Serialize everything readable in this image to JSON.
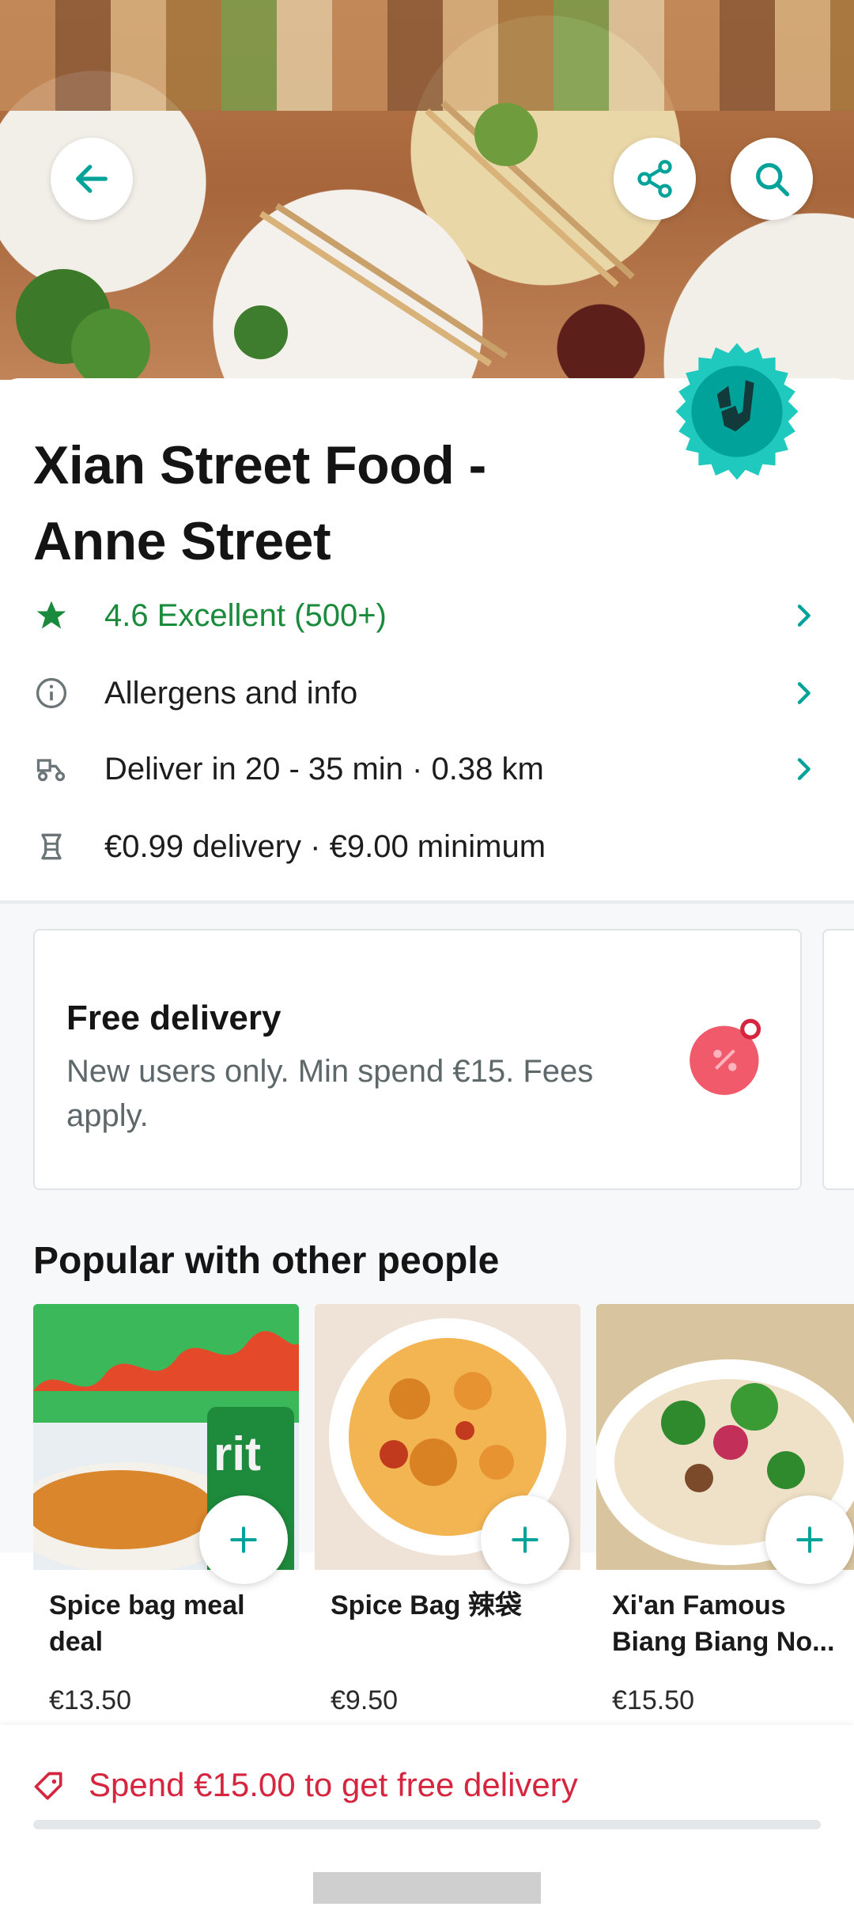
{
  "header": {
    "back_icon": "arrow-left-icon",
    "share_icon": "share-icon",
    "search_icon": "search-icon"
  },
  "restaurant": {
    "name": "Xian Street Food - Anne Street",
    "rating_text": "4.6 Excellent (500+)",
    "allergens_text": "Allergens and info",
    "delivery_time_text": "Deliver in 20 - 35 min · 0.38 km",
    "fees_text": "€0.99 delivery · €9.00 minimum"
  },
  "promo": {
    "title": "Free delivery",
    "description": "New users only. Min spend €15. Fees apply."
  },
  "popular": {
    "heading": "Popular with other people",
    "items": [
      {
        "name": "Spice bag meal deal",
        "price": "€13.50"
      },
      {
        "name": "Spice Bag 辣袋",
        "price": "€9.50"
      },
      {
        "name": "Xi'an Famous Biang Biang No...",
        "price": "€15.50"
      }
    ]
  },
  "basket": {
    "free_delivery_text": "Spend €15.00 to get free delivery",
    "progress_fraction": 0.0
  },
  "colors": {
    "accent_teal": "#00a29a",
    "rating_green": "#1a8a3c",
    "alert_red": "#d6253f"
  }
}
